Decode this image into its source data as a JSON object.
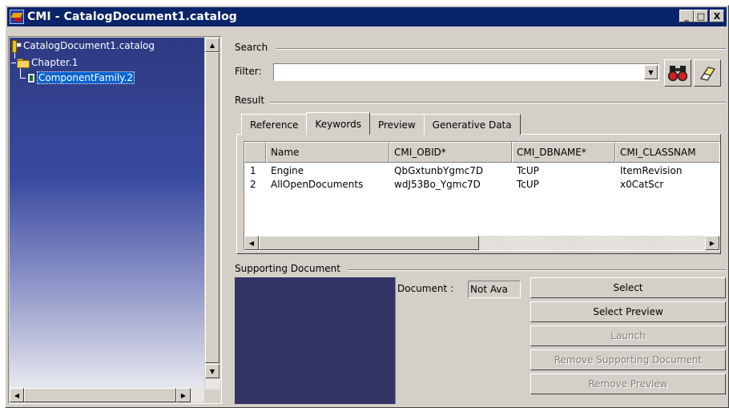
{
  "window": {
    "title": "CMI - CatalogDocument1.catalog",
    "controls": [
      "_",
      "□",
      "X"
    ]
  },
  "tree": {
    "root": "CatalogDocument1.catalog",
    "chapter": "Chapter.1",
    "family": "ComponentFamily.2"
  },
  "search": {
    "group_label": "Search",
    "filter_label": "Filter:",
    "filter_value": ""
  },
  "result": {
    "group_label": "Result",
    "tabs": [
      "Reference",
      "Keywords",
      "Preview",
      "Generative Data"
    ],
    "active_tab": "Keywords",
    "columns": [
      "",
      "Name",
      "CMI_OBID*",
      "CMI_DBNAME*",
      "CMI_CLASSNAM"
    ],
    "rows": [
      [
        "1",
        "Engine",
        "QbGxtunbYgmc7D",
        "TcUP",
        "ItemRevision"
      ],
      [
        "2",
        "AllOpenDocuments",
        "wdJ53Bo_Ygmc7D",
        "TcUP",
        "x0CatScr"
      ]
    ]
  },
  "supporting": {
    "group_label": "Supporting Document",
    "document_label": "Document :",
    "document_value": "Not Ava",
    "buttons": {
      "select": "Select",
      "select_preview": "Select Preview",
      "launch": "Launch",
      "remove_supporting": "Remove Supporting Document",
      "remove_preview": "Remove Preview"
    }
  },
  "colors": {
    "title_bar": "#0a246a",
    "tree_background": "#2d3a82",
    "selection": "#0a64d0",
    "preview_background": "#343366"
  },
  "icons": [
    "app-icon",
    "catalog-icon",
    "folder-icon",
    "component-family-icon",
    "binoculars-icon",
    "eraser-icon"
  ]
}
